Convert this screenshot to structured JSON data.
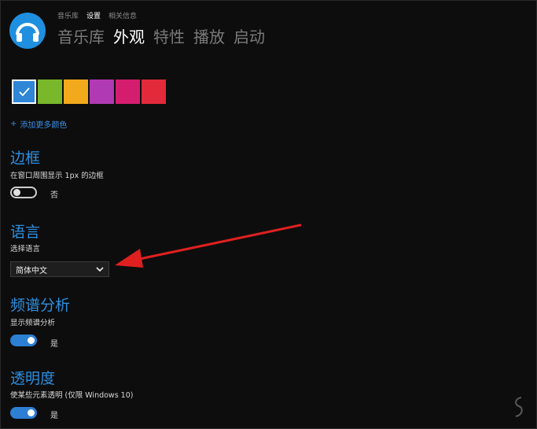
{
  "breadcrumbs": [
    {
      "label": "音乐库",
      "active": false
    },
    {
      "label": "设置",
      "active": true
    },
    {
      "label": "相关信息",
      "active": false
    }
  ],
  "tabs": [
    {
      "label": "音乐库",
      "active": false
    },
    {
      "label": "外观",
      "active": true
    },
    {
      "label": "特性",
      "active": false
    },
    {
      "label": "播放",
      "active": false
    },
    {
      "label": "启动",
      "active": false
    }
  ],
  "appearance": {
    "colors": [
      "#2f86d7",
      "#78b82a",
      "#f2a91b",
      "#b03ab3",
      "#d51d6f",
      "#e32a3a"
    ],
    "selected_color_index": 0,
    "add_more_label": "添加更多颜色"
  },
  "border": {
    "title": "边框",
    "description": "在窗口周围显示 1px 的边框",
    "toggle_state": "否"
  },
  "language": {
    "title": "语言",
    "description": "选择语言",
    "selected": "简体中文"
  },
  "spectrum": {
    "title": "频谱分析",
    "description": "显示频谱分析",
    "toggle_state": "是"
  },
  "transparency": {
    "title": "透明度",
    "description": "使某些元素透明 (仅限 Windows 10)",
    "toggle_state": "是"
  },
  "icons": {
    "logo": "headphones-icon",
    "check": "check-icon",
    "add": "plus-icon",
    "dropdown": "chevron-down-icon"
  },
  "annotation_color": "#e02020"
}
